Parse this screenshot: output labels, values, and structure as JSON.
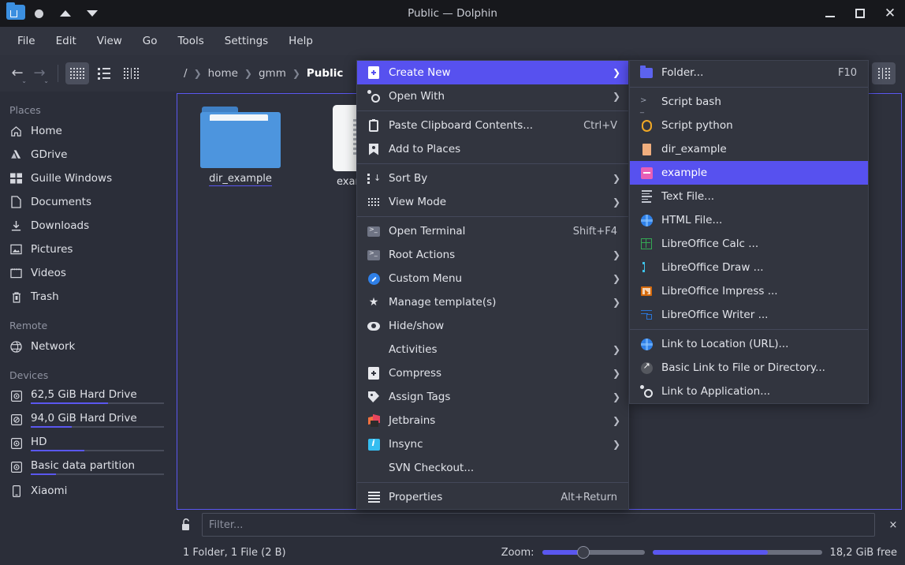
{
  "window": {
    "title": "Public — Dolphin",
    "app_icon": "folder-home-icon",
    "controls": {
      "minimize": "minimize-icon",
      "maximize": "maximize-icon",
      "close": "close-icon"
    },
    "extra_buttons": [
      "record-dot-icon",
      "caret-up-icon",
      "caret-down-icon"
    ]
  },
  "menubar": {
    "items": [
      "File",
      "Edit",
      "View",
      "Go",
      "Tools",
      "Settings",
      "Help"
    ]
  },
  "toolbar": {
    "back": "back-arrow-icon",
    "forward": "forward-arrow-icon",
    "view_modes": [
      "icons-view-icon",
      "compact-view-icon",
      "details-view-icon"
    ],
    "active_view_mode": 0,
    "split_button": "split-view-icon",
    "breadcrumb": [
      "/",
      "home",
      "gmm",
      "Public"
    ],
    "breadcrumb_current_index": 3
  },
  "sidebar": {
    "groups": [
      {
        "header": "Places",
        "items": [
          {
            "label": "Home",
            "icon": "home-icon"
          },
          {
            "label": "GDrive",
            "icon": "gdrive-icon"
          },
          {
            "label": "Guille Windows",
            "icon": "windows-icon"
          },
          {
            "label": "Documents",
            "icon": "document-icon"
          },
          {
            "label": "Downloads",
            "icon": "download-icon"
          },
          {
            "label": "Pictures",
            "icon": "picture-icon"
          },
          {
            "label": "Videos",
            "icon": "video-icon"
          },
          {
            "label": "Trash",
            "icon": "trash-icon"
          }
        ]
      },
      {
        "header": "Remote",
        "items": [
          {
            "label": "Network",
            "icon": "network-icon"
          }
        ]
      },
      {
        "header": "Devices",
        "items": [
          {
            "label": "62,5 GiB Hard Drive",
            "icon": "disk-icon",
            "usage": 58
          },
          {
            "label": "94,0 GiB Hard Drive",
            "icon": "disk-icon",
            "usage": 31
          },
          {
            "label": "HD",
            "icon": "disk-icon",
            "usage": 40
          },
          {
            "label": "Basic data partition",
            "icon": "disk-icon",
            "usage": 19
          },
          {
            "label": "Xiaomi",
            "icon": "phone-icon"
          }
        ]
      }
    ]
  },
  "content": {
    "files": [
      {
        "name": "dir_example",
        "type": "folder",
        "selected_underline": true
      },
      {
        "name": "example",
        "type": "file",
        "selected_underline": false
      }
    ]
  },
  "context_menu": {
    "items": [
      {
        "label": "Create New",
        "icon": "new-file-icon",
        "submenu": true,
        "selected": true
      },
      {
        "label": "Open With",
        "icon": "open-with-icon",
        "submenu": true
      },
      {
        "separator_after": true
      },
      {
        "label": "Paste Clipboard Contents...",
        "icon": "clipboard-icon",
        "shortcut": "Ctrl+V"
      },
      {
        "label": "Add to Places",
        "icon": "bookmark-icon"
      },
      {
        "separator_after": true
      },
      {
        "label": "Sort By",
        "icon": "sort-icon",
        "submenu": true
      },
      {
        "label": "View Mode",
        "icon": "view-mode-icon",
        "submenu": true
      },
      {
        "separator_after": true
      },
      {
        "label": "Open Terminal",
        "icon": "terminal-icon",
        "shortcut": "Shift+F4"
      },
      {
        "label": "Root Actions",
        "icon": "terminal-icon",
        "submenu": true
      },
      {
        "label": "Custom Menu",
        "icon": "custom-menu-icon",
        "submenu": true
      },
      {
        "label": "Manage template(s)",
        "icon": "star-icon",
        "submenu": true
      },
      {
        "label": "Hide/show",
        "icon": "eye-icon"
      },
      {
        "label": "Activities",
        "icon": "none",
        "submenu": true
      },
      {
        "label": "Compress",
        "icon": "compress-icon",
        "submenu": true
      },
      {
        "label": "Assign Tags",
        "icon": "tag-icon",
        "submenu": true
      },
      {
        "label": "Jetbrains",
        "icon": "jetbrains-icon",
        "submenu": true
      },
      {
        "label": "Insync",
        "icon": "insync-icon",
        "submenu": true
      },
      {
        "label": "SVN Checkout...",
        "icon": "none"
      },
      {
        "separator_after": true
      },
      {
        "label": "Properties",
        "icon": "properties-icon",
        "shortcut": "Alt+Return"
      }
    ]
  },
  "submenu": {
    "items": [
      {
        "label": "Folder...",
        "icon": "folder-icon",
        "shortcut": "F10"
      },
      {
        "separator_after": true
      },
      {
        "label": "Script bash",
        "icon": "bash-icon"
      },
      {
        "label": "Script python",
        "icon": "python-icon"
      },
      {
        "label": "dir_example",
        "icon": "dir-template-icon"
      },
      {
        "label": "example",
        "icon": "example-template-icon",
        "selected": true
      },
      {
        "label": "Text File...",
        "icon": "text-file-icon"
      },
      {
        "label": "HTML File...",
        "icon": "html-file-icon"
      },
      {
        "label": "LibreOffice Calc  ...",
        "icon": "calc-icon"
      },
      {
        "label": "LibreOffice Draw  ...",
        "icon": "draw-icon"
      },
      {
        "label": "LibreOffice Impress  ...",
        "icon": "impress-icon"
      },
      {
        "label": "LibreOffice Writer  ...",
        "icon": "writer-icon"
      },
      {
        "separator_after": true
      },
      {
        "label": "Link to Location (URL)...",
        "icon": "globe-icon"
      },
      {
        "label": "Basic Link to File or Directory...",
        "icon": "link-icon"
      },
      {
        "label": "Link to Application...",
        "icon": "app-link-icon"
      }
    ]
  },
  "bottom": {
    "lock_icon": "unlocked-icon",
    "filter_placeholder": "Filter...",
    "filter_value": "",
    "close_filter": "×",
    "status_text": "1 Folder, 1 File (2 B)",
    "zoom_label": "Zoom:",
    "zoom_percent": 40,
    "capacity_percent": 68,
    "free_space": "18,2 GiB free"
  },
  "colors": {
    "accent": "#5751ef",
    "titlebar_bg": "#17181c",
    "menubar_bg": "#31343f",
    "window_bg": "#2b2e39",
    "menu_bg": "#32353f"
  }
}
